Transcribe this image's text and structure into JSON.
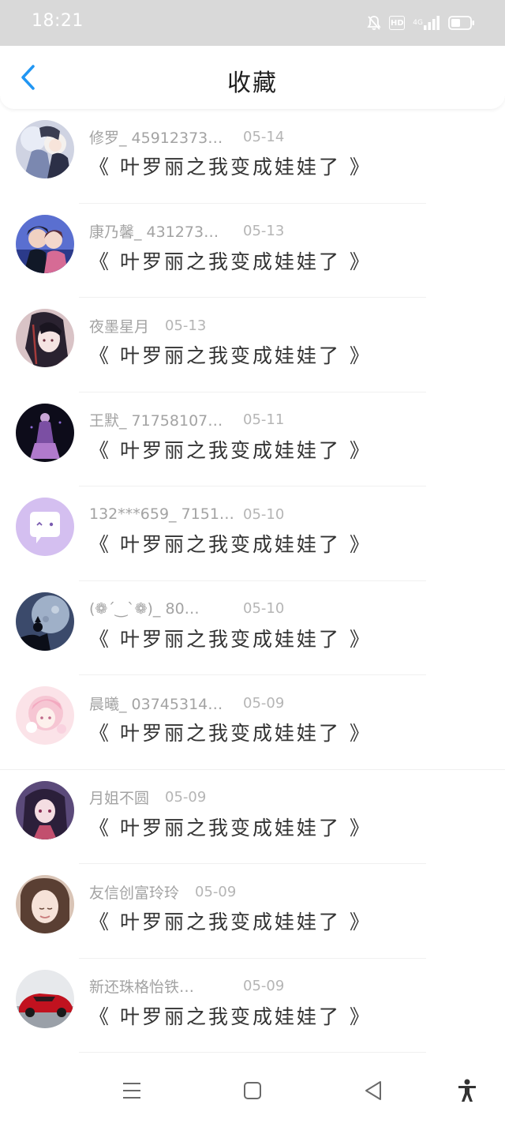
{
  "status_bar": {
    "time": "18:21",
    "hd": "HD",
    "network": "4G",
    "icons": [
      "mute-icon",
      "hd-icon",
      "signal-icon",
      "battery-icon"
    ]
  },
  "header": {
    "title": "收藏",
    "back_icon": "chevron-left-icon",
    "accent": "#2196f3"
  },
  "items": [
    {
      "name": "修罗_ 45912373…",
      "date": "05-14",
      "title": "《 叶罗丽之我变成娃娃了 》"
    },
    {
      "name": "康乃馨_ 431273…",
      "date": "05-13",
      "title": "《 叶罗丽之我变成娃娃了 》"
    },
    {
      "name": "夜墨星月",
      "date": "05-13",
      "title": "《 叶罗丽之我变成娃娃了 》"
    },
    {
      "name": "王默_ 71758107…",
      "date": "05-11",
      "title": "《 叶罗丽之我变成娃娃了 》"
    },
    {
      "name": "132***659_ 7151…",
      "date": "05-10",
      "title": "《 叶罗丽之我变成娃娃了 》"
    },
    {
      "name": "(❁ˊ‿ˋ❁)_ 80…",
      "date": "05-10",
      "title": "《 叶罗丽之我变成娃娃了 》"
    },
    {
      "name": "晨曦_ 03745314…",
      "date": "05-09",
      "title": "《 叶罗丽之我变成娃娃了 》"
    },
    {
      "name": "月姐不圆",
      "date": "05-09",
      "title": "《 叶罗丽之我变成娃娃了 》"
    },
    {
      "name": "友信创富玲玲",
      "date": "05-09",
      "title": "《 叶罗丽之我变成娃娃了 》"
    },
    {
      "name": "新还珠格怡铁…",
      "date": "05-09",
      "title": "《 叶罗丽之我变成娃娃了 》"
    }
  ],
  "nav": {
    "icons": [
      "menu-icon",
      "home-icon",
      "back-icon",
      "accessibility-icon"
    ]
  }
}
